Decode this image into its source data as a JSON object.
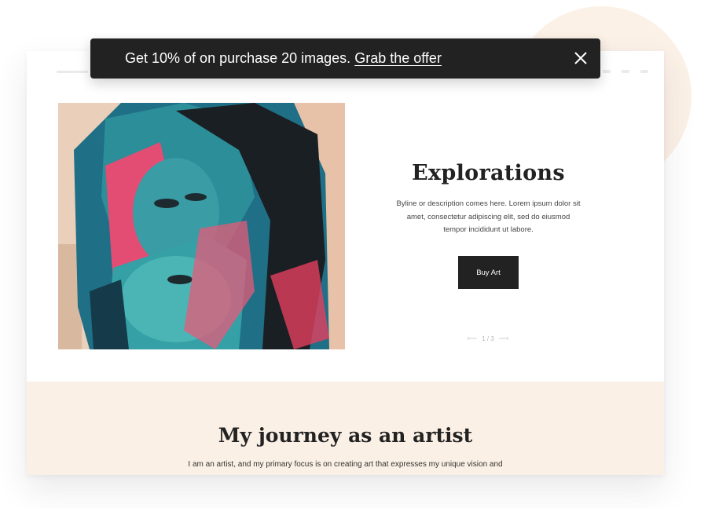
{
  "promo": {
    "text": "Get 10% of on purchase 20 images.",
    "link": "Grab the offer",
    "close_icon": "close-icon"
  },
  "hero": {
    "title": "Explorations",
    "byline": "Byline or description comes here. Lorem ipsum dolor sit amet, consectetur adipiscing elit, sed do eiusmod tempor incididunt ut labore.",
    "button": "Buy Art",
    "pager": {
      "prev_icon": "arrow-left-icon",
      "label": "1 / 3",
      "next_icon": "arrow-right-icon"
    },
    "image": "portrait-artwork"
  },
  "journey": {
    "title": "My journey as an artist",
    "text": "I am an artist, and my primary focus is on creating art that expresses my unique vision and"
  },
  "colors": {
    "dark": "#222222",
    "cream": "#fbf0e5",
    "teal": "#2e8a93",
    "pink": "#e34b6f"
  }
}
